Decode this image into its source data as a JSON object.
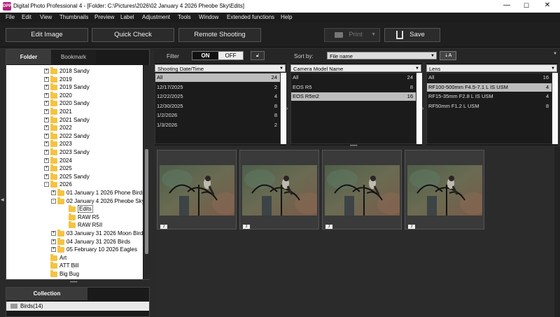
{
  "title": {
    "text": "Digital Photo Professional 4 - [Folder: C:\\Pictures\\2026\\02 January 4 2026 Pheobe Sky\\Edits]",
    "icon": "DPP"
  },
  "window": {
    "minimize": "—",
    "maximize": "☐",
    "close": "✕"
  },
  "menu": [
    "File",
    "Edit",
    "View",
    "Thumbnails",
    "Preview",
    "Label",
    "Adjustment",
    "Tools",
    "Window",
    "Extended functions",
    "Help"
  ],
  "toolbar": {
    "edit_image": "Edit Image",
    "quick_check": "Quick Check",
    "remote_shooting": "Remote Shooting",
    "print": "Print",
    "save": "Save"
  },
  "left": {
    "tab_folder": "Folder",
    "tab_bookmark": "Bookmark",
    "tree": [
      {
        "label": "2018 Sandy",
        "level": 1,
        "exp": "+"
      },
      {
        "label": "2019",
        "level": 1,
        "exp": "+"
      },
      {
        "label": "2019 Sandy",
        "level": 1,
        "exp": "+"
      },
      {
        "label": "2020",
        "level": 1,
        "exp": "+"
      },
      {
        "label": "2020 Sandy",
        "level": 1,
        "exp": "+"
      },
      {
        "label": "2021",
        "level": 1,
        "exp": "+"
      },
      {
        "label": "2021 Sandy",
        "level": 1,
        "exp": "+"
      },
      {
        "label": "2022",
        "level": 1,
        "exp": "+"
      },
      {
        "label": "2022 Sandy",
        "level": 1,
        "exp": "+"
      },
      {
        "label": "2023",
        "level": 1,
        "exp": "+"
      },
      {
        "label": "2023 Sandy",
        "level": 1,
        "exp": "+"
      },
      {
        "label": "2024",
        "level": 1,
        "exp": "+"
      },
      {
        "label": "2025",
        "level": 1,
        "exp": "+"
      },
      {
        "label": "2025 Sandy",
        "level": 1,
        "exp": "+"
      },
      {
        "label": "2026",
        "level": 1,
        "exp": "-"
      },
      {
        "label": "01 January 1 2026 Phone Birds",
        "level": 2,
        "exp": "+"
      },
      {
        "label": "02 January 4 2026 Pheobe Sky",
        "level": 2,
        "exp": "-"
      },
      {
        "label": "Edits",
        "level": 3,
        "exp": "",
        "selected": true
      },
      {
        "label": "RAW R5",
        "level": 3,
        "exp": ""
      },
      {
        "label": "RAW R5II",
        "level": 3,
        "exp": ""
      },
      {
        "label": "03 January 31 2026 Moon Bird",
        "level": 2,
        "exp": "+"
      },
      {
        "label": "04 January 31 2026 Birds",
        "level": 2,
        "exp": "+"
      },
      {
        "label": "05 February 10 2026 Eagles",
        "level": 2,
        "exp": "+"
      },
      {
        "label": "Art",
        "level": 1,
        "exp": ""
      },
      {
        "label": "ATT Bill",
        "level": 1,
        "exp": ""
      },
      {
        "label": "Big Bug",
        "level": 1,
        "exp": ""
      }
    ],
    "collection_tab": "Collection",
    "collection_item": "Birds(14)"
  },
  "filter": {
    "label": "Filter",
    "on": "ON",
    "off": "OFF",
    "sort_label": "Sort by:",
    "sort_value": "File name"
  },
  "columns": [
    {
      "header": "Shooting Date/Time",
      "rows": [
        {
          "label": "All",
          "count": "24",
          "selected": true
        },
        {
          "label": "12/17/2025",
          "count": "2"
        },
        {
          "label": "12/22/2025",
          "count": "4"
        },
        {
          "label": "12/30/2025",
          "count": "8"
        },
        {
          "label": "1/2/2026",
          "count": "8"
        },
        {
          "label": "1/3/2026",
          "count": "2"
        }
      ]
    },
    {
      "header": "Camera Model Name",
      "rows": [
        {
          "label": "All",
          "count": "24"
        },
        {
          "label": "EOS R5",
          "count": "8"
        },
        {
          "label": "EOS R5m2",
          "count": "16",
          "selected": true
        }
      ]
    },
    {
      "header": "Lens",
      "rows": [
        {
          "label": "All",
          "count": "16"
        },
        {
          "label": "RF100-500mm F4.5-7.1 L IS USM",
          "count": "4",
          "selected": true
        },
        {
          "label": "RF15-35mm F2.8 L IS USM",
          "count": "4"
        },
        {
          "label": "RF50mm F1.2 L USM",
          "count": "8"
        }
      ]
    }
  ],
  "thumbnails": [
    {
      "badge": "J"
    },
    {
      "badge": "J"
    },
    {
      "badge": "J"
    },
    {
      "badge": "J"
    }
  ],
  "colors": {
    "accent": "#b0217a",
    "folder": "#f5c343",
    "selected": "#bdbdbd"
  }
}
